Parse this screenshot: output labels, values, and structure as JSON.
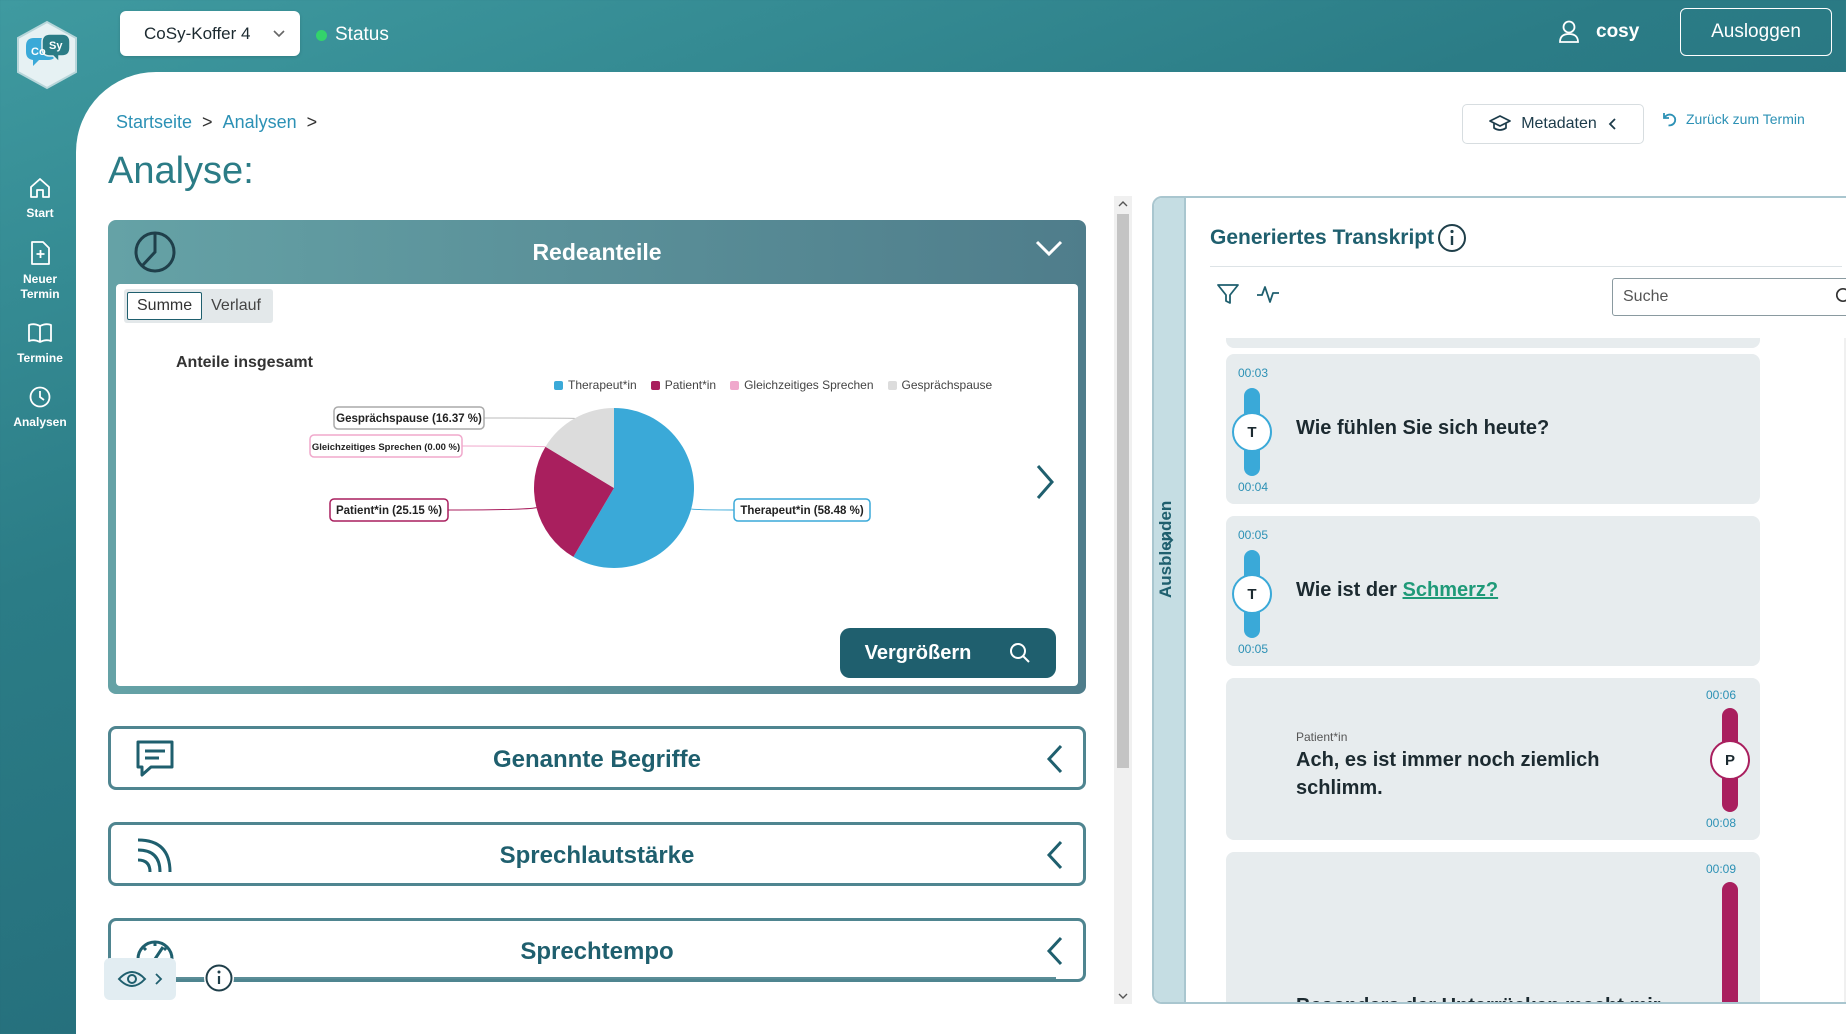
{
  "header": {
    "device_select": "CoSy-Koffer 4",
    "status_label": "Status",
    "user_name": "cosy",
    "logout_label": "Ausloggen",
    "logo_text_left": "Co",
    "logo_text_right": "Sy"
  },
  "nav": {
    "items": [
      {
        "label": "Start",
        "icon": "home-icon"
      },
      {
        "label": "Neuer Termin",
        "icon": "new-document-icon"
      },
      {
        "label": "Termine",
        "icon": "book-icon"
      },
      {
        "label": "Analysen",
        "icon": "clock-history-icon"
      }
    ]
  },
  "breadcrumb": {
    "items": [
      "Startseite",
      "Analysen"
    ],
    "separator": ">"
  },
  "page": {
    "title": "Analyse:",
    "metadata_button": "Metadaten",
    "back_link": "Zurück zum Termin"
  },
  "redeanteile": {
    "title": "Redeanteile",
    "tabs": [
      "Summe",
      "Verlauf"
    ],
    "active_tab": "Summe",
    "zoom_button": "Vergrößern"
  },
  "chart_data": {
    "type": "pie",
    "title": "Anteile insgesamt",
    "slices": [
      {
        "label": "Therapeut*in",
        "value": 58.48,
        "color": "#3aa9d8",
        "callout": "Therapeut*in (58.48 %)"
      },
      {
        "label": "Patient*in",
        "value": 25.15,
        "color": "#a91f5e",
        "callout": "Patient*in (25.15 %)"
      },
      {
        "label": "Gleichzeitiges Sprechen",
        "value": 0.0,
        "color": "#f0a8cc",
        "callout": "Gleichzeitiges Sprechen (0.00 %)"
      },
      {
        "label": "Gesprächspause",
        "value": 16.37,
        "color": "#dcdcdc",
        "callout": "Gesprächspause (16.37 %)"
      }
    ],
    "legend_position": "top-right"
  },
  "sections": [
    {
      "title": "Genannte Begriffe",
      "icon": "speech-bubble-icon"
    },
    {
      "title": "Sprechlautstärke",
      "icon": "signal-waves-icon"
    },
    {
      "title": "Sprechtempo",
      "icon": "speedometer-icon"
    }
  ],
  "transcript": {
    "title": "Generiertes Transkript",
    "hide_label": "Ausblenden",
    "search_placeholder": "Suche",
    "entries": [
      {
        "start": "00:03",
        "end": "00:04",
        "speaker_badge": "T",
        "speaker": "",
        "text": "Wie fühlen Sie sich heute?",
        "keyword": "",
        "color": "#3aa9d8"
      },
      {
        "start": "00:05",
        "end": "00:05",
        "speaker_badge": "T",
        "speaker": "",
        "text_before": "Wie ist der ",
        "keyword": "Schmerz?",
        "color": "#3aa9d8"
      },
      {
        "start": "00:06",
        "end": "00:08",
        "speaker_badge": "P",
        "speaker": "Patient*in",
        "text": "Ach, es ist immer noch ziemlich schlimm.",
        "color": "#a91f5e"
      },
      {
        "start": "00:09",
        "end": "",
        "speaker_badge": "P",
        "speaker": "",
        "text": "Besonders der Unterrücken macht mir",
        "color": "#a91f5e"
      }
    ]
  }
}
